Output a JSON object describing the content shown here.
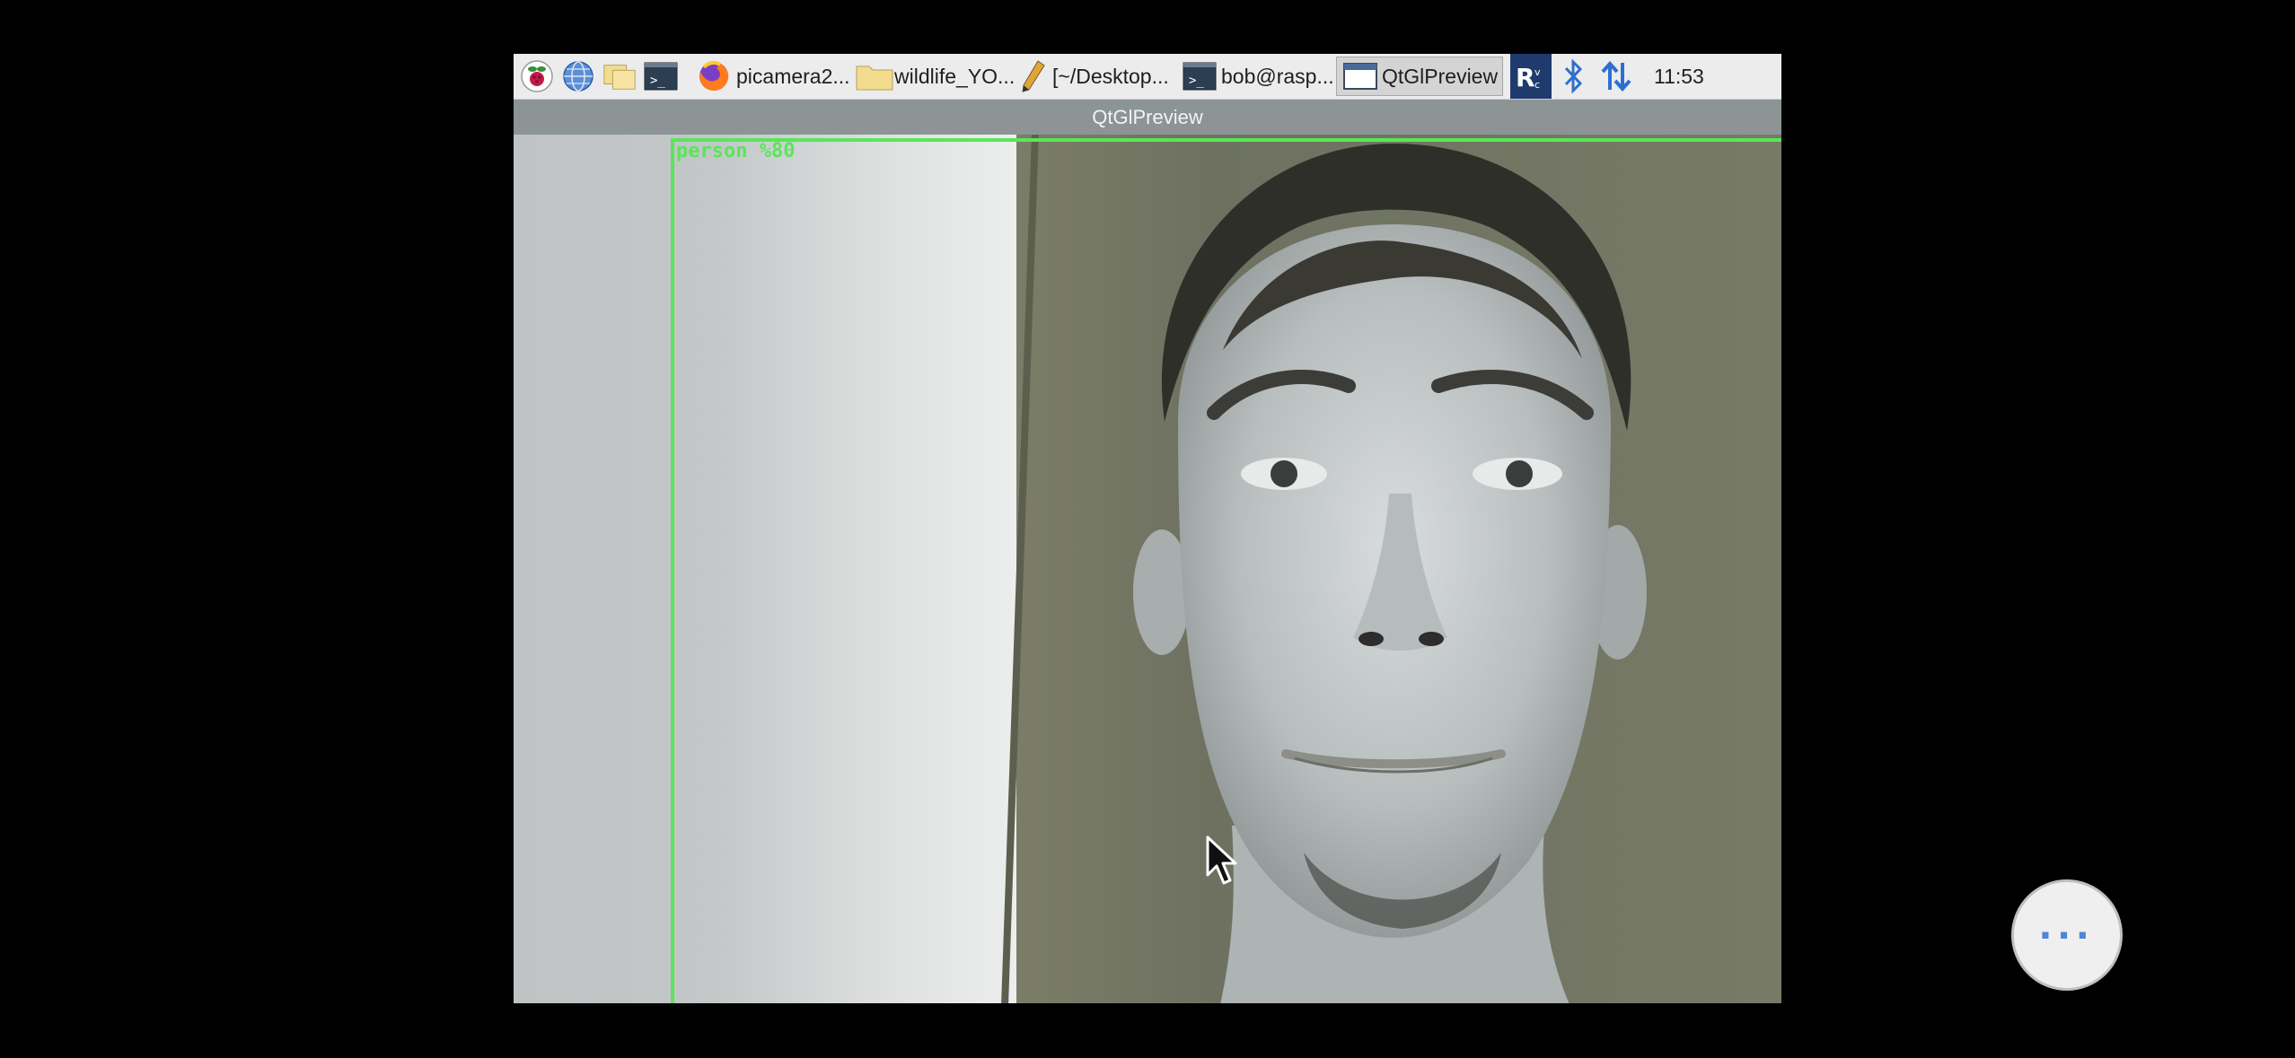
{
  "taskbar": {
    "launchers": [
      {
        "name": "raspberry-menu-icon"
      },
      {
        "name": "web-browser-icon"
      },
      {
        "name": "file-manager-icon"
      },
      {
        "name": "terminal-icon"
      }
    ],
    "tasks": [
      {
        "icon": "firefox-icon",
        "label": "picamera2..."
      },
      {
        "icon": "folder-icon",
        "label": "wildlife_YO..."
      },
      {
        "icon": "text-editor-icon",
        "label": "[~/Desktop..."
      },
      {
        "icon": "terminal-icon",
        "label": "bob@rasp..."
      },
      {
        "icon": "window-icon",
        "label": "QtGlPreview",
        "active": true
      }
    ],
    "tray": [
      "vnc-icon",
      "bluetooth-icon",
      "network-arrows-icon"
    ],
    "clock": "11:53"
  },
  "window": {
    "title": "QtGlPreview"
  },
  "detection": {
    "label": "person %80",
    "color": "#59e659"
  },
  "overlay_button": {
    "label": "···"
  },
  "colors": {
    "taskbar_bg": "#ececec",
    "titlebar_bg": "#8d9496",
    "accent_blue": "#4f86d8"
  }
}
